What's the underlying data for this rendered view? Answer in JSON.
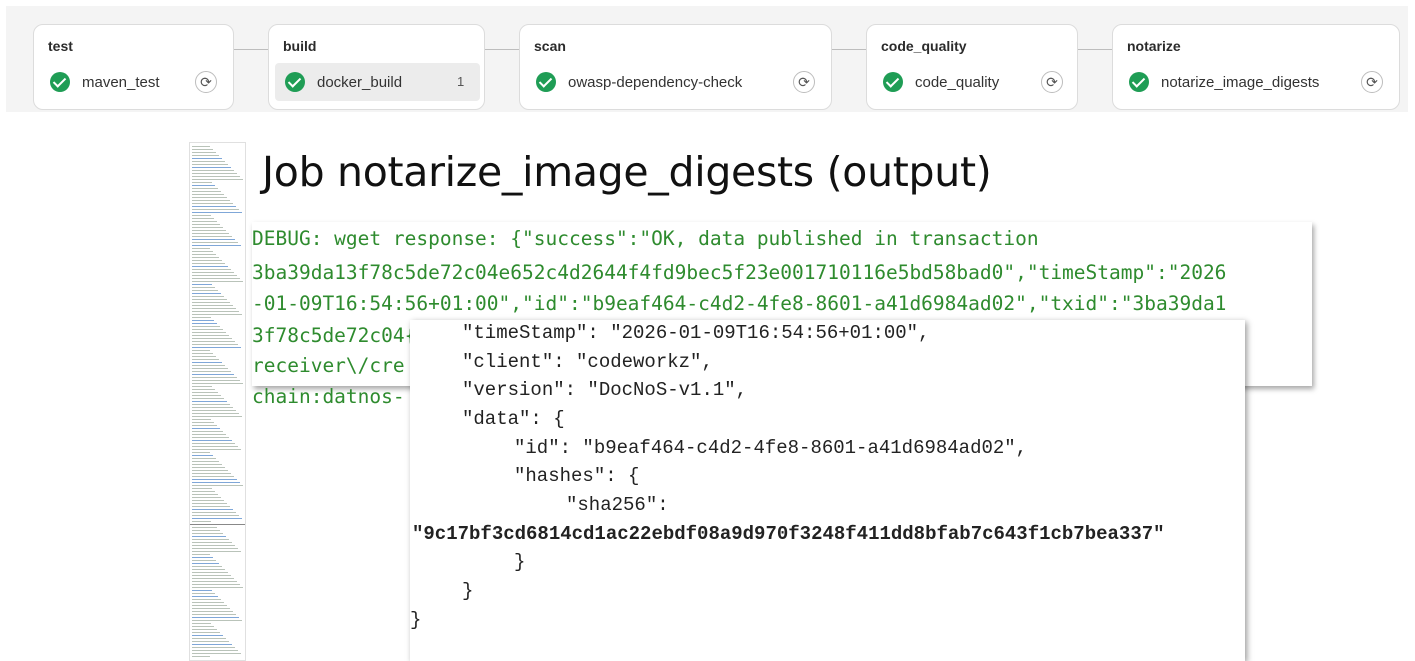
{
  "pipeline": {
    "stages": [
      {
        "name": "test",
        "job": "maven_test"
      },
      {
        "name": "build",
        "job": "docker_build",
        "count": "1"
      },
      {
        "name": "scan",
        "job": "owasp-dependency-check"
      },
      {
        "name": "code_quality",
        "job": "code_quality"
      },
      {
        "name": "notarize",
        "job": "notarize_image_digests"
      }
    ]
  },
  "title": "Job notarize_image_digests (output)",
  "debug_lines": [
    "DEBUG: wget response: {\"success\":\"OK, data published in transaction",
    "3ba39da13f78c5de72c04e652c4d2644f4fd9bec5f23e001710116e5bd58bad0\",\"timeStamp\":\"2026",
    "-01-09T16:54:56+01:00\",\"id\":\"b9eaf464-c4d2-4fe8-8601-a41d6984ad02\",\"txid\":\"3ba39da1",
    "3f78c5de72c04{",
    "receiver\\/cre",
    "chain:datnos-"
  ],
  "json_lines": [
    "\"timeStamp\": \"2026-01-09T16:54:56+01:00\",",
    "\"client\": \"codeworkz\",",
    "\"version\": \"DocNoS-v1.1\",",
    "\"data\": {",
    "\"id\": \"b9eaf464-c4d2-4fe8-8601-a41d6984ad02\",",
    "\"hashes\": {",
    "\"sha256\":",
    "\"9c17bf3cd6814cd1ac22ebdf08a9d970f3248f411dd8bfab7c643f1cb7bea337\"",
    "}",
    "}",
    "}"
  ],
  "icons": {
    "status": "check-circle-icon",
    "retry": "retry-icon"
  },
  "colors": {
    "success": "#1f9d55",
    "debug_text": "#2e8b2e"
  }
}
